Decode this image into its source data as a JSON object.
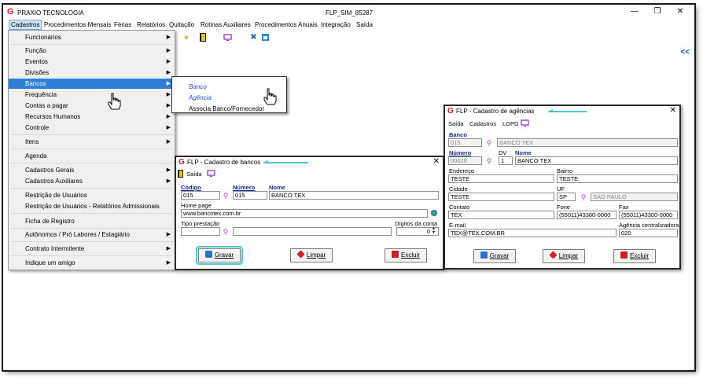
{
  "window": {
    "app_name": "PRAXIO TECNOLOGIA",
    "title": "FLP_SIM_85287",
    "minimize": "—",
    "maximize": "❐",
    "close": "✕"
  },
  "menubar": [
    "Cadastros",
    "Procedimentos Mensais",
    "Férias",
    "Relatórios",
    "Quitação",
    "Rotinas Auxiliares",
    "Procedimentos Anuais",
    "Integração",
    "Saída"
  ],
  "toolbar": {
    "collapse": "<<"
  },
  "cadastros_menu": [
    {
      "label": "Funcionários",
      "arrow": "▶"
    },
    {
      "label": "Função",
      "arrow": "▶"
    },
    {
      "label": "Eventos",
      "arrow": "▶"
    },
    {
      "label": "Divisões",
      "arrow": "▶"
    },
    {
      "label": "Bancos",
      "arrow": "▶"
    },
    {
      "label": "Frequência",
      "arrow": "▶"
    },
    {
      "label": "Contas a pagar",
      "arrow": "▶"
    },
    {
      "label": "Recursos Humanos",
      "arrow": "▶"
    },
    {
      "label": "Controle",
      "arrow": "▶"
    },
    {
      "label": "Itens",
      "arrow": "▶"
    },
    {
      "label": "Agenda",
      "arrow": ""
    },
    {
      "label": "Cadastros Gerais",
      "arrow": "▶"
    },
    {
      "label": "Cadastros Auxiliares",
      "arrow": "▶"
    },
    {
      "label": "Restrição de Usuários",
      "arrow": ""
    },
    {
      "label": "Restrição de Usuários - Relatórios Admissionais",
      "arrow": ""
    },
    {
      "label": "Ficha de Registro",
      "arrow": ""
    },
    {
      "label": "Autônomos / Pró Labores / Estagiário",
      "arrow": "▶"
    },
    {
      "label": "Contrato Intermitente",
      "arrow": "▶"
    },
    {
      "label": "Indique um amigo",
      "arrow": "▶"
    }
  ],
  "bancos_submenu": [
    "Banco",
    "Agência",
    "Associa Banco/Fornecedor"
  ],
  "banco_dialog": {
    "title": "FLP - Cadastro de bancos",
    "menu_saida": "Saída",
    "codigo_label": "Código",
    "codigo_value": "015",
    "numero_label": "Número",
    "numero_value": "015",
    "nome_label": "Nome",
    "nome_value": "BANCO TEX",
    "homepage_label": "Home page",
    "homepage_value": "www.bancotex.com.br",
    "tipo_label": "Tipo prestação",
    "tipo_value": "",
    "digitos_label": "Dígitos da conta",
    "digitos_value": "0",
    "gravar": "Gravar",
    "limpar": "Limpar",
    "excluir": "Excluir"
  },
  "agencia_dialog": {
    "title": "FLP - Cadastro de agências",
    "menu": [
      "Saída",
      "Cadastros",
      "LGPD"
    ],
    "banco_label": "Banco",
    "banco_code": "015",
    "banco_name": "BANCO TEX",
    "numero_label": "Número",
    "numero_value": "00020",
    "dv_label": "DV",
    "dv_value": "1",
    "nome_label": "Nome",
    "nome_value": "BANCO TEX",
    "endereco_label": "Endereço",
    "endereco_value": "TESTE",
    "bairro_label": "Bairro",
    "bairro_value": "TESTE",
    "cidade_label": "Cidade",
    "cidade_value": "TESTE",
    "uf_label": "UF",
    "uf_value": "SP",
    "uf_name": "SAO PAULO",
    "contato_label": "Contato",
    "contato_value": "TEX",
    "fone_label": "Fone",
    "fone_value": "(55011)43300-0000",
    "fax_label": "Fax",
    "fax_value": "(55011)43300-0000",
    "email_label": "E-mail",
    "email_value": "TEX@TEX.COM.BR",
    "agencia_central_label": "Agência centralizadora",
    "agencia_central_value": "020",
    "gravar": "Gravar",
    "limpar": "Limpar",
    "excluir": "Excluir"
  },
  "colors": {
    "highlight": "#2f7fd6",
    "brand_red": "#d21c1c",
    "label_blue": "#1a2a8a",
    "callout_cyan": "#4fc6cf"
  }
}
